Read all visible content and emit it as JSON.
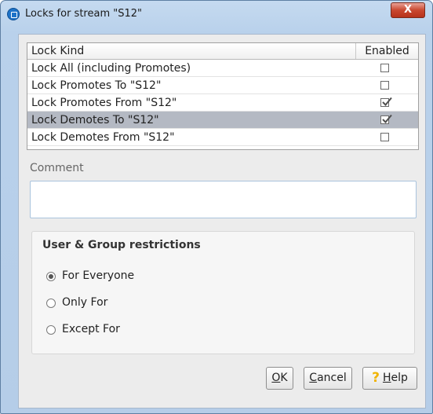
{
  "window": {
    "title": "Locks for stream \"S12\"",
    "close_glyph": "X"
  },
  "table": {
    "columns": [
      "Lock Kind",
      "Enabled"
    ],
    "rows": [
      {
        "kind": "Lock All (including Promotes)",
        "enabled": false,
        "selected": false
      },
      {
        "kind": "Lock Promotes To \"S12\"",
        "enabled": false,
        "selected": false
      },
      {
        "kind": "Lock Promotes From \"S12\"",
        "enabled": true,
        "selected": false
      },
      {
        "kind": "Lock Demotes To \"S12\"",
        "enabled": true,
        "selected": true
      },
      {
        "kind": "Lock Demotes From \"S12\"",
        "enabled": false,
        "selected": false
      }
    ]
  },
  "comment": {
    "label": "Comment",
    "value": ""
  },
  "restrictions": {
    "title": "User & Group restrictions",
    "options": [
      {
        "label": "For Everyone",
        "selected": true
      },
      {
        "label": "Only For",
        "selected": false
      },
      {
        "label": "Except For",
        "selected": false
      }
    ]
  },
  "buttons": {
    "ok": {
      "mnemonic": "O",
      "rest": "K"
    },
    "cancel": {
      "mnemonic": "C",
      "rest": "ancel"
    },
    "help": {
      "mnemonic": "H",
      "rest": "elp",
      "icon": "question-icon",
      "icon_glyph": "?",
      "icon_color": "#f0b400"
    }
  },
  "colors": {
    "selected_row": "#b4b9c3",
    "frame": "#b9d1eb",
    "close_button": "#c9472f"
  }
}
